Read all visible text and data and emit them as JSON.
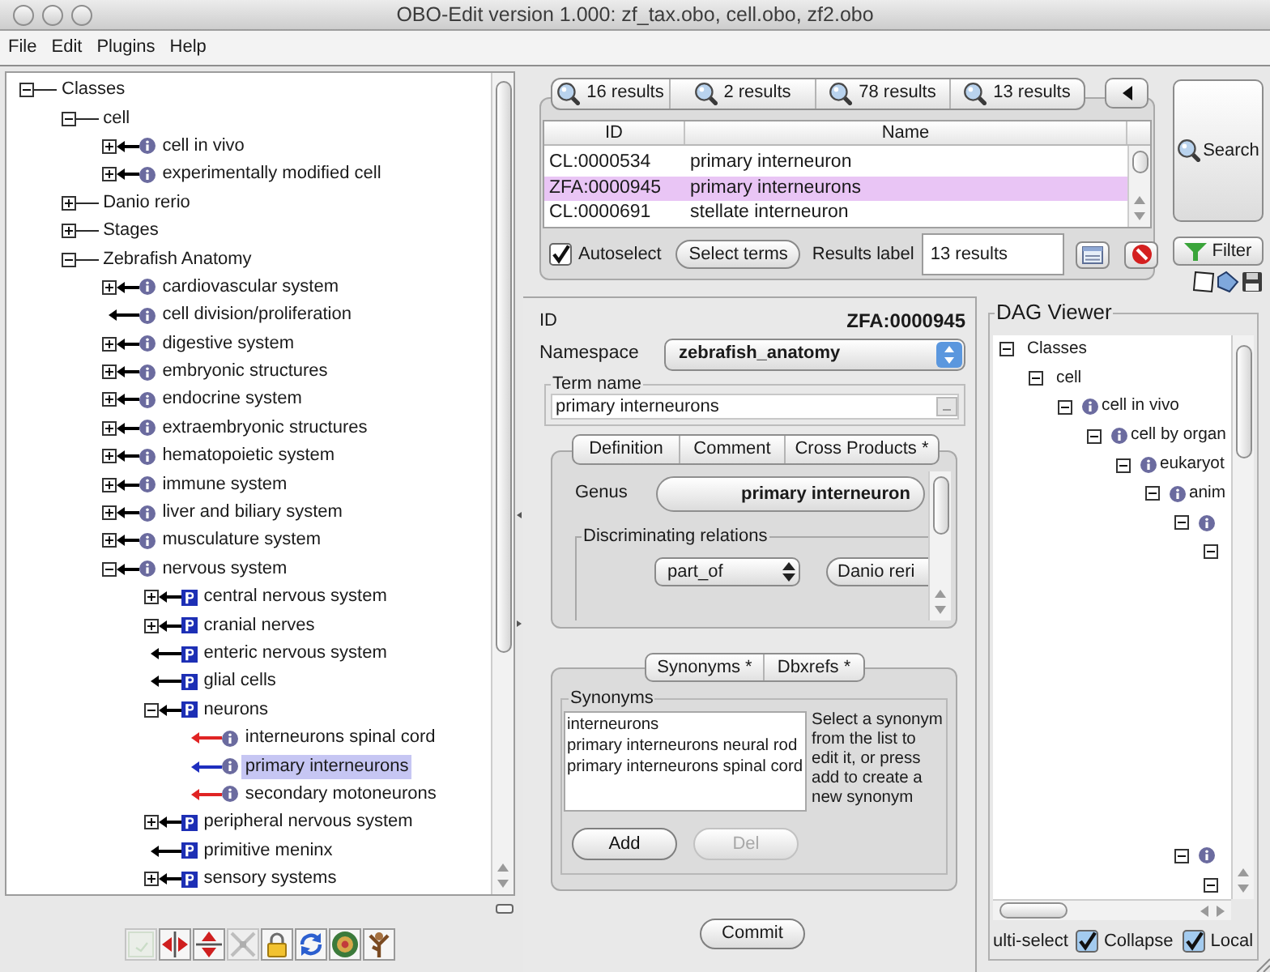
{
  "window": {
    "title": "OBO-Edit version 1.000: zf_tax.obo, cell.obo, zf2.obo"
  },
  "menu": [
    "File",
    "Edit",
    "Plugins",
    "Help"
  ],
  "ontology_tree": {
    "nodes": [
      {
        "label": "Classes",
        "kind": "group",
        "expanded": true,
        "selected": false,
        "children": [
          {
            "label": "cell",
            "kind": "group",
            "expanded": true,
            "selected": false,
            "children": [
              {
                "label": "cell in vivo",
                "kind": "is_a",
                "expanded": false,
                "color": "#000000",
                "selected": false
              },
              {
                "label": "experimentally modified cell",
                "kind": "is_a",
                "expanded": false,
                "color": "#000000",
                "selected": false
              }
            ]
          },
          {
            "label": "Danio rerio",
            "kind": "group",
            "expanded": false,
            "selected": false
          },
          {
            "label": "Stages",
            "kind": "group",
            "expanded": false,
            "selected": false
          },
          {
            "label": "Zebrafish Anatomy",
            "kind": "group",
            "expanded": true,
            "selected": false,
            "children": [
              {
                "label": "cardiovascular system",
                "kind": "is_a",
                "expanded": false,
                "color": "#000000",
                "selected": false
              },
              {
                "label": "cell division/proliferation",
                "kind": "is_a",
                "color": "#000000",
                "selected": false
              },
              {
                "label": "digestive system",
                "kind": "is_a",
                "expanded": false,
                "color": "#000000",
                "selected": false
              },
              {
                "label": "embryonic structures",
                "kind": "is_a",
                "expanded": false,
                "color": "#000000",
                "selected": false
              },
              {
                "label": "endocrine system",
                "kind": "is_a",
                "expanded": false,
                "color": "#000000",
                "selected": false
              },
              {
                "label": "extraembryonic structures",
                "kind": "is_a",
                "expanded": false,
                "color": "#000000",
                "selected": false
              },
              {
                "label": "hematopoietic system",
                "kind": "is_a",
                "expanded": false,
                "color": "#000000",
                "selected": false
              },
              {
                "label": "immune system",
                "kind": "is_a",
                "expanded": false,
                "color": "#000000",
                "selected": false
              },
              {
                "label": "liver and biliary system",
                "kind": "is_a",
                "expanded": false,
                "color": "#000000",
                "selected": false
              },
              {
                "label": "musculature system",
                "kind": "is_a",
                "expanded": false,
                "color": "#000000",
                "selected": false
              },
              {
                "label": "nervous system",
                "kind": "is_a",
                "expanded": true,
                "color": "#000000",
                "selected": false,
                "children": [
                  {
                    "label": "central nervous system",
                    "kind": "part_of",
                    "expanded": false,
                    "color": "#000000",
                    "selected": false
                  },
                  {
                    "label": "cranial nerves",
                    "kind": "part_of",
                    "expanded": false,
                    "color": "#000000",
                    "selected": false
                  },
                  {
                    "label": "enteric nervous system",
                    "kind": "part_of",
                    "color": "#000000",
                    "selected": false
                  },
                  {
                    "label": "glial cells",
                    "kind": "part_of",
                    "color": "#000000",
                    "selected": false
                  },
                  {
                    "label": "neurons",
                    "kind": "part_of",
                    "expanded": true,
                    "color": "#000000",
                    "selected": false,
                    "children": [
                      {
                        "label": "interneurons spinal cord",
                        "kind": "is_a",
                        "color": "#e02424",
                        "selected": false
                      },
                      {
                        "label": "primary interneurons",
                        "kind": "is_a",
                        "color": "#1f2fbf",
                        "selected": true
                      },
                      {
                        "label": "secondary motoneurons",
                        "kind": "is_a",
                        "color": "#e02424",
                        "selected": false
                      }
                    ]
                  },
                  {
                    "label": "peripheral nervous system",
                    "kind": "part_of",
                    "expanded": false,
                    "color": "#000000",
                    "selected": false
                  },
                  {
                    "label": "primitive meninx",
                    "kind": "part_of",
                    "color": "#000000",
                    "selected": false
                  },
                  {
                    "label": "sensory systems",
                    "kind": "part_of",
                    "expanded": false,
                    "color": "#000000",
                    "selected": false
                  }
                ]
              }
            ]
          }
        ]
      }
    ]
  },
  "tree_toolbar": [
    {
      "kind": "tile",
      "disabled": true
    },
    {
      "kind": "hsplit",
      "disabled": false
    },
    {
      "kind": "vsplit",
      "disabled": false
    },
    {
      "kind": "cross",
      "disabled": true
    },
    {
      "kind": "lock",
      "disabled": false
    },
    {
      "kind": "cycle",
      "disabled": false
    },
    {
      "kind": "rings",
      "disabled": false
    },
    {
      "kind": "branches",
      "disabled": false
    }
  ],
  "search": {
    "tabs": [
      "16 results",
      "2 results",
      "78 results",
      "13 results"
    ],
    "table": {
      "columns": [
        "ID",
        "Name"
      ],
      "rows": [
        {
          "id": "CL:0000534",
          "name": "primary interneuron",
          "selected": false
        },
        {
          "id": "ZFA:0000945",
          "name": "primary interneurons",
          "selected": true
        },
        {
          "id": "CL:0000691",
          "name": "stellate interneuron",
          "selected": false
        }
      ]
    },
    "autoselect": {
      "label": "Autoselect",
      "checked": true
    },
    "select_button": "Select terms",
    "results_label": "Results label",
    "results_field": "13 results",
    "search_button": "Search",
    "filter_button": "Filter"
  },
  "term_editor": {
    "id_label": "ID",
    "id": "ZFA:0000945",
    "namespace_label": "Namespace",
    "namespace": "zebrafish_anatomy",
    "term_name_label": "Term name",
    "term_name": "primary interneurons",
    "tabs": [
      "Definition",
      "Comment",
      "Cross Products *"
    ],
    "genus_label": "Genus",
    "genus": "primary interneuron",
    "relations_label": "Discriminating relations",
    "relation": "part_of",
    "relation_target": "Danio reri",
    "synonym_tabs": [
      "Synonyms *",
      "Dbxrefs *"
    ],
    "synonyms_label": "Synonyms",
    "synonyms": [
      "interneurons",
      "primary interneurons neural rod",
      "primary interneurons spinal cord"
    ],
    "synonym_help": "Select a synonym from the list to edit it, or press add to create a new synonym",
    "add_button": {
      "label": "Add",
      "disabled": false
    },
    "del_button": {
      "label": "Del",
      "disabled": true
    },
    "commit_button": "Commit"
  },
  "dag_viewer": {
    "title": "DAG Viewer",
    "nodes": [
      {
        "label": "Classes",
        "kind": "group",
        "expanded": true,
        "children": [
          {
            "label": "cell",
            "kind": "group",
            "expanded": true,
            "children": [
              {
                "label": "cell in vivo",
                "kind": "is_a",
                "expanded": true,
                "children": [
                  {
                    "label": "cell by organ",
                    "kind": "is_a",
                    "expanded": true,
                    "children": [
                      {
                        "label": "eukaryot",
                        "kind": "is_a",
                        "expanded": true,
                        "children": [
                          {
                            "label": "anim",
                            "kind": "is_a",
                            "expanded": true,
                            "children": [
                              {
                                "kind": "is_a",
                                "expanded": true,
                                "children": [
                                  {
                                    "expanded": true
                                  }
                                ]
                              }
                            ]
                          }
                        ]
                      }
                    ]
                  }
                ]
              }
            ]
          }
        ]
      }
    ],
    "lower_nodes": [
      {
        "kind": "is_a",
        "expanded": true,
        "children": [
          {
            "expanded": true
          }
        ]
      }
    ],
    "multi_select_label": "ulti-select",
    "collapse": {
      "label": "Collapse",
      "checked": true
    },
    "local": {
      "label": "Local",
      "checked": true
    }
  }
}
